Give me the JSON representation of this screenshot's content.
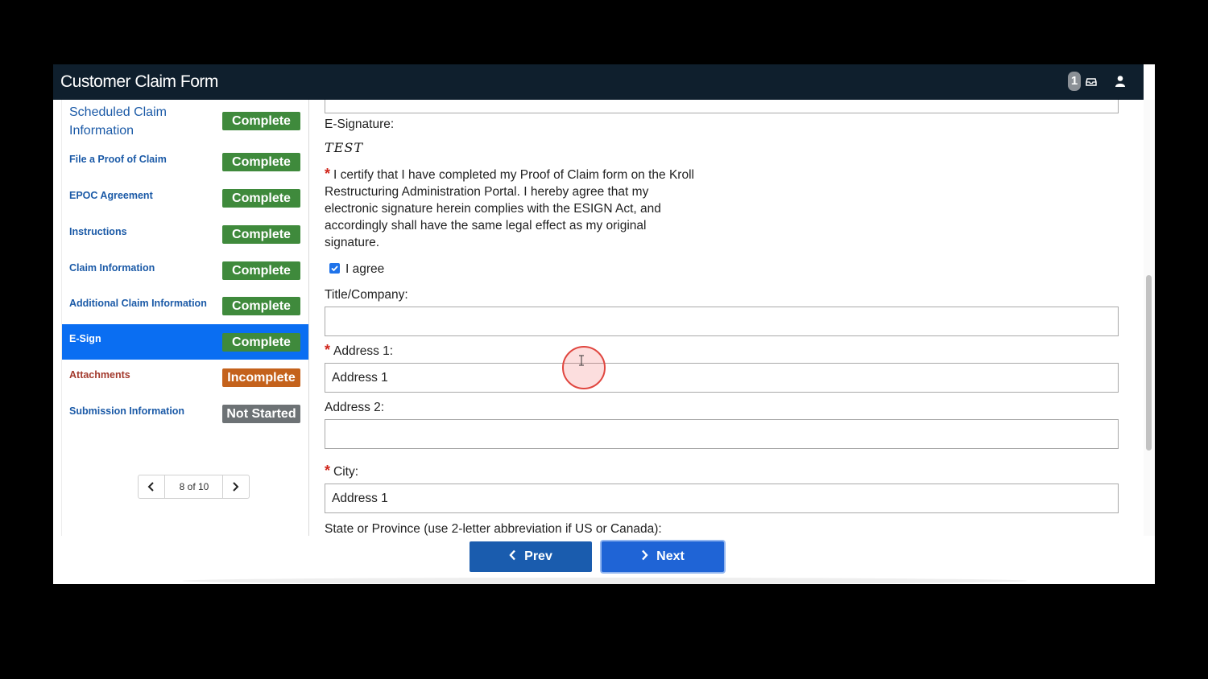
{
  "header": {
    "title": "Customer Claim Form",
    "notification_count": "1"
  },
  "sidebar": {
    "items": [
      {
        "label": "Scheduled Claim Information",
        "status": "Complete"
      },
      {
        "label": "File a Proof of Claim",
        "status": "Complete"
      },
      {
        "label": "EPOC Agreement",
        "status": "Complete"
      },
      {
        "label": "Instructions",
        "status": "Complete"
      },
      {
        "label": "Claim Information",
        "status": "Complete"
      },
      {
        "label": "Additional Claim Information",
        "status": "Complete"
      },
      {
        "label": "E-Sign",
        "status": "Complete"
      },
      {
        "label": "Attachments",
        "status": "Incomplete"
      },
      {
        "label": "Submission Information",
        "status": "Not Started"
      }
    ],
    "pager": {
      "text": "8 of 10"
    }
  },
  "form": {
    "esignature_label": "E-Signature:",
    "esignature_value": "TEST",
    "certification": "I certify that I have completed my Proof of Claim form on the Kroll Restructuring Administration Portal. I hereby agree that my electronic signature herein complies with the ESIGN Act, and accordingly shall have the same legal effect as my original signature.",
    "agree_label": "I agree",
    "title_company_label": "Title/Company:",
    "title_company_value": "",
    "address1_label": "Address 1:",
    "address1_value": "Address 1",
    "address2_label": "Address 2:",
    "address2_value": "",
    "city_label": "City:",
    "city_value": "Address 1",
    "state_label": "State or Province (use 2-letter abbreviation if US or Canada):"
  },
  "footer": {
    "prev_label": "Prev",
    "next_label": "Next"
  },
  "colors": {
    "header_bg": "#0f1f2d",
    "active_nav": "#0a6ef2",
    "complete": "#3f8a3c",
    "incomplete": "#c4621c",
    "not_started": "#6d7275",
    "required": "#d0261c"
  }
}
